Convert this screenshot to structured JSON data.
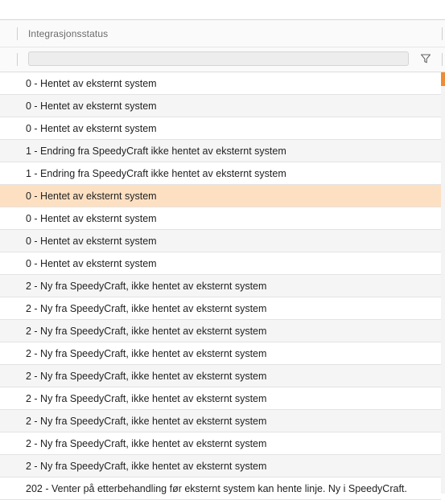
{
  "grid": {
    "column_header": "Integrasjonsstatus",
    "filter": {
      "value": "",
      "placeholder": ""
    },
    "selected_row": 5,
    "rows": [
      {
        "status": "0 - Hentet av eksternt system"
      },
      {
        "status": "0 - Hentet av eksternt system"
      },
      {
        "status": "0 - Hentet av eksternt system"
      },
      {
        "status": "1 - Endring fra SpeedyCraft ikke hentet av eksternt system"
      },
      {
        "status": "1 - Endring fra SpeedyCraft ikke hentet av eksternt system"
      },
      {
        "status": "0 - Hentet av eksternt system"
      },
      {
        "status": "0 - Hentet av eksternt system"
      },
      {
        "status": "0 - Hentet av eksternt system"
      },
      {
        "status": "0 - Hentet av eksternt system"
      },
      {
        "status": "2 - Ny fra SpeedyCraft, ikke hentet av eksternt system"
      },
      {
        "status": "2 - Ny fra SpeedyCraft, ikke hentet av eksternt system"
      },
      {
        "status": "2 - Ny fra SpeedyCraft, ikke hentet av eksternt system"
      },
      {
        "status": "2 - Ny fra SpeedyCraft, ikke hentet av eksternt system"
      },
      {
        "status": "2 - Ny fra SpeedyCraft, ikke hentet av eksternt system"
      },
      {
        "status": "2 - Ny fra SpeedyCraft, ikke hentet av eksternt system"
      },
      {
        "status": "2 - Ny fra SpeedyCraft, ikke hentet av eksternt system"
      },
      {
        "status": "2 - Ny fra SpeedyCraft, ikke hentet av eksternt system"
      },
      {
        "status": "2 - Ny fra SpeedyCraft, ikke hentet av eksternt system"
      },
      {
        "status": "202 - Venter på etterbehandling før eksternt system kan hente linje. Ny i SpeedyCraft."
      }
    ]
  },
  "icons": {
    "filter": "filter-funnel-icon"
  },
  "colors": {
    "selected_row": "#fde0c2",
    "scrollbar_thumb": "#ef8a36",
    "alt_row": "#f5f5f5"
  }
}
